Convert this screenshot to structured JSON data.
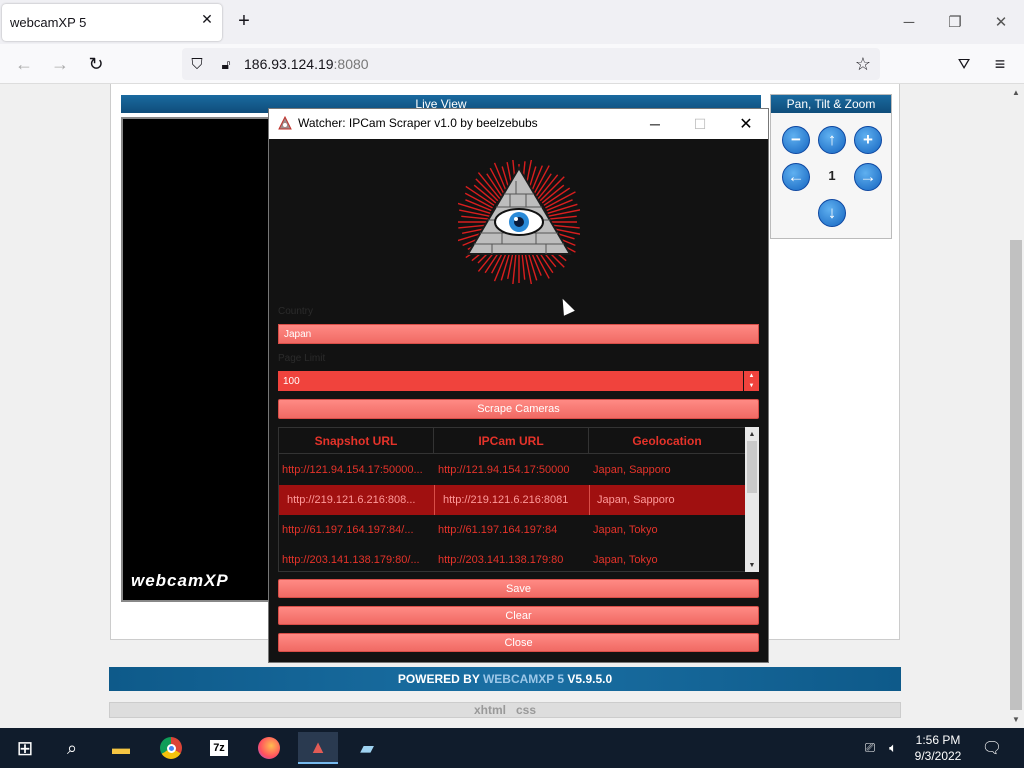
{
  "browser": {
    "tab_title": "webcamXP 5",
    "url_host": "186.93.124.19",
    "url_port": ":8080"
  },
  "page": {
    "live_view_label": "Live View",
    "logo_text": "webcamXP",
    "ptz_header": "Pan, Tilt & Zoom",
    "ptz_value": "1",
    "powered_prefix": "POWERED BY ",
    "powered_brand": "WEBCAMXP 5",
    "powered_version": " V5.9.5.0",
    "footer_link_1": "xhtml",
    "footer_link_2": "css"
  },
  "dialog": {
    "title": "Watcher: IPCam Scraper v1.0 by beelzebubs",
    "country_label": "Country",
    "country_value": "Japan",
    "page_limit_label": "Page Limit",
    "page_limit_value": "100",
    "scrape_button": "Scrape Cameras",
    "columns": [
      "Snapshot URL",
      "IPCam URL",
      "Geolocation"
    ],
    "rows": [
      [
        "http://121.94.154.17:50000...",
        "http://121.94.154.17:50000",
        "Japan, Sapporo"
      ],
      [
        "http://219.121.6.216:808...",
        "http://219.121.6.216:8081",
        "Japan, Sapporo"
      ],
      [
        "http://61.197.164.197:84/...",
        "http://61.197.164.197:84",
        "Japan, Tokyo"
      ],
      [
        "http://203.141.138.179:80/...",
        "http://203.141.138.179:80",
        "Japan, Tokyo"
      ]
    ],
    "selected_row": 1,
    "save_button": "Save",
    "clear_button": "Clear",
    "close_button": "Close"
  },
  "taskbar": {
    "time": "1:56 PM",
    "date": "9/3/2022"
  },
  "colors": {
    "accent_red": "#f0433d",
    "table_text": "#e5332a",
    "selected_row": "#a01010",
    "header_blue": "#0f4d7a"
  }
}
